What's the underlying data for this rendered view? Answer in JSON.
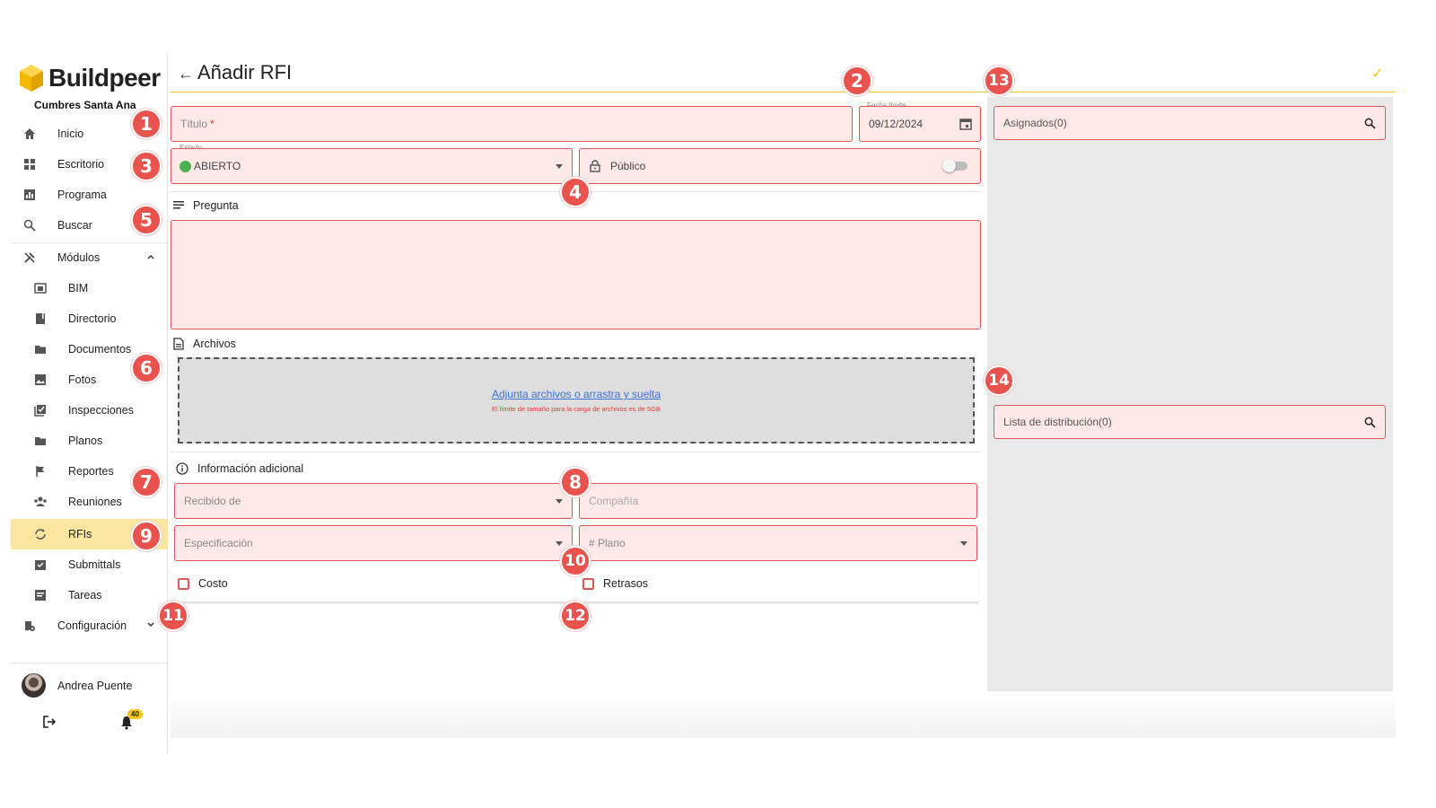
{
  "brand": {
    "name": "Buildpeer",
    "project": "Cumbres Santa Ana"
  },
  "sidebar": {
    "items": [
      {
        "label": "Inicio",
        "icon": "home-icon"
      },
      {
        "label": "Escritorio",
        "icon": "dashboard-icon"
      },
      {
        "label": "Programa",
        "icon": "chart-icon"
      },
      {
        "label": "Buscar",
        "icon": "search-icon"
      },
      {
        "label": "Módulos",
        "icon": "tools-icon"
      },
      {
        "label": "BIM",
        "icon": "bim-icon"
      },
      {
        "label": "Directorio",
        "icon": "book-icon"
      },
      {
        "label": "Documentos",
        "icon": "folder-icon"
      },
      {
        "label": "Fotos",
        "icon": "image-icon"
      },
      {
        "label": "Inspecciones",
        "icon": "checklist-icon"
      },
      {
        "label": "Planos",
        "icon": "map-folder-icon"
      },
      {
        "label": "Reportes",
        "icon": "flag-icon"
      },
      {
        "label": "Reuniones",
        "icon": "people-icon"
      },
      {
        "label": "RFIs",
        "icon": "sync-icon"
      },
      {
        "label": "Submittals",
        "icon": "assignment-icon"
      },
      {
        "label": "Tareas",
        "icon": "task-icon"
      },
      {
        "label": "Configuración",
        "icon": "settings-icon"
      }
    ],
    "user": {
      "name": "Andrea Puente"
    },
    "notifications": "40",
    "active": "RFIs"
  },
  "header": {
    "back": "←",
    "title": "Añadir RFI",
    "check": "✓"
  },
  "form": {
    "titulo_placeholder": "Título",
    "titulo_required": "*",
    "fecha_label": "Fecha límite",
    "fecha_value": "09/12/2024",
    "estado_label": "Estado",
    "estado_value": "ABIERTO",
    "publico_label": "Público",
    "pregunta_label": "Pregunta",
    "archivos_label": "Archivos",
    "dropzone_link": "Adjunta archivos o arrastra y suelta",
    "dropzone_note": "El límite de tamaño para la carga de archivos es de 5GB",
    "info_label": "Información adicional",
    "recibido_placeholder": "Recibido de",
    "compania_placeholder": "Compañía",
    "especificacion_placeholder": "Especificación",
    "plano_placeholder": "# Plano",
    "costo_label": "Costo",
    "retrasos_label": "Retrasos"
  },
  "right_panel": {
    "asignados": "Asignados(0)",
    "distribucion": "Lista de distribución(0)"
  },
  "markers": [
    "1",
    "2",
    "3",
    "4",
    "5",
    "6",
    "7",
    "8",
    "9",
    "10",
    "11",
    "12",
    "13",
    "14"
  ],
  "colors": {
    "accent": "#f0c419",
    "error_border": "#e05555",
    "field_bg": "#ffe8e8",
    "marker": "#e8534d",
    "active_nav": "#fbe6a0"
  }
}
